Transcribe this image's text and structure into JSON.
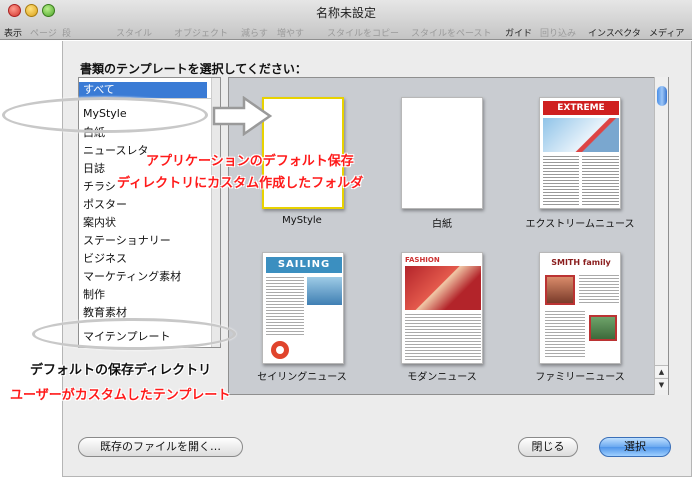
{
  "window": {
    "title": "名称未設定",
    "toolbar": [
      {
        "label": "表示",
        "enabled": true
      },
      {
        "label": "ページ",
        "enabled": false
      },
      {
        "label": "段",
        "enabled": false
      },
      {
        "label": "スタイル",
        "enabled": false
      },
      {
        "label": "オブジェクト",
        "enabled": false
      },
      {
        "label": "減らす",
        "enabled": false
      },
      {
        "label": "増やす",
        "enabled": false
      },
      {
        "label": "スタイルをコピー",
        "enabled": false
      },
      {
        "label": "スタイルをペースト",
        "enabled": false
      },
      {
        "label": "ガイド",
        "enabled": true
      },
      {
        "label": "回り込み",
        "enabled": false
      },
      {
        "label": "インスペクタ",
        "enabled": true
      },
      {
        "label": "メディア",
        "enabled": true
      }
    ]
  },
  "dialog": {
    "prompt": "書類のテンプレートを選択してください：",
    "categories": [
      {
        "label": "すべて",
        "selected": true
      },
      {
        "label": "MyStyle",
        "selected": false
      },
      {
        "label": "白紙",
        "selected": false
      },
      {
        "label": "ニュースレタ",
        "selected": false
      },
      {
        "label": "日誌",
        "selected": false
      },
      {
        "label": "チラシ",
        "selected": false
      },
      {
        "label": "ポスター",
        "selected": false
      },
      {
        "label": "案内状",
        "selected": false
      },
      {
        "label": "ステーショナリー",
        "selected": false
      },
      {
        "label": "ビジネス",
        "selected": false
      },
      {
        "label": "マーケティング素材",
        "selected": false
      },
      {
        "label": "制作",
        "selected": false
      },
      {
        "label": "教育素材",
        "selected": false
      },
      {
        "label": "マイテンプレート",
        "selected": false
      }
    ],
    "templates": [
      {
        "label": "MyStyle",
        "selected": true
      },
      {
        "label": "白紙",
        "selected": false
      },
      {
        "label": "エクストリームニュース",
        "selected": false,
        "thumb_title": "EXTREME"
      },
      {
        "label": "セイリングニュース",
        "selected": false,
        "thumb_title": "SAILING"
      },
      {
        "label": "モダンニュース",
        "selected": false,
        "thumb_title": "FASHION"
      },
      {
        "label": "ファミリーニュース",
        "selected": false,
        "thumb_title": "SMITH family"
      }
    ],
    "buttons": {
      "open_existing": "既存のファイルを開く…",
      "close": "閉じる",
      "choose": "選択"
    }
  },
  "annotations": {
    "app_default_line1": "アプリケーションのデフォルト保存",
    "app_default_line2": "ディレクトリにカスタム作成したフォルダ",
    "default_save_dir": "デフォルトの保存ディレクトリ",
    "user_custom": "ユーザーがカスタムしたテンプレート"
  },
  "colors": {
    "selection_blue": "#3a7bd5",
    "annotation_red": "#ff1a1a",
    "thumb_selected_border": "#e8d200"
  }
}
